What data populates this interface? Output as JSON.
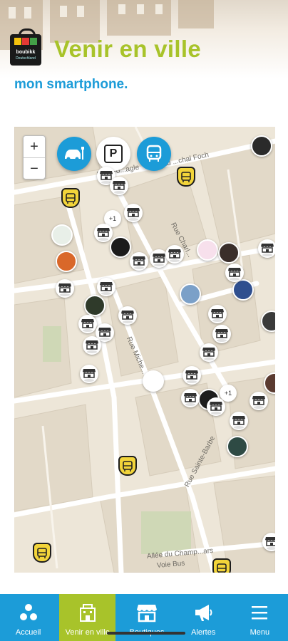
{
  "header": {
    "logo_line1": "boubikk",
    "logo_line2": "Deutschland",
    "title": "Venir en ville",
    "subtitle": "mon smartphone."
  },
  "map": {
    "zoom_in": "+",
    "zoom_out": "−",
    "filters": [
      {
        "name": "car-parking-filter",
        "icon": "car-icon"
      },
      {
        "name": "parking-filter",
        "label": "P"
      },
      {
        "name": "bus-filter",
        "icon": "bus-icon"
      }
    ],
    "streets": [
      "Rue Fo...agle",
      "Rue du ...chal Foch",
      "Rue Charl...",
      "Rue Miche...",
      "Rue Sainte-Barbe",
      "Allée du Champ...ars",
      "Voie Bus"
    ],
    "clusters": [
      "+1",
      "+1"
    ]
  },
  "nav": {
    "items": [
      {
        "label": "Accueil",
        "icon": "home-dots-icon"
      },
      {
        "label": "Venir en ville",
        "icon": "city-icon"
      },
      {
        "label": "Boutiques",
        "icon": "shop-icon"
      },
      {
        "label": "Alertes",
        "icon": "megaphone-icon"
      },
      {
        "label": "Menu",
        "icon": "menu-icon"
      }
    ],
    "active_index": 1
  },
  "colors": {
    "title_green": "#a8c32a",
    "accent_blue": "#1c9cd8",
    "map_bg": "#ede6d8",
    "bus_yellow": "#f2d43a"
  }
}
